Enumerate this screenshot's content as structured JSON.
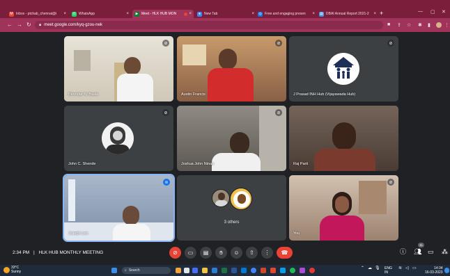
{
  "browser": {
    "tabs": [
      {
        "label": "Inbox - ptchab_chennai@i",
        "icon": "gmail-icon",
        "color": "#ea4335",
        "active": false
      },
      {
        "label": "WhatsApp",
        "icon": "whatsapp-icon",
        "color": "#25d366",
        "active": false
      },
      {
        "label": "Meet - HLK HUB MON",
        "icon": "meet-icon",
        "color": "#00832d",
        "active": true
      },
      {
        "label": "New Tab",
        "icon": "chrome-icon",
        "color": "#4285f4",
        "active": false
      },
      {
        "label": "Free and engaging presen",
        "icon": "mentimeter-icon",
        "color": "#1a73e8",
        "active": false
      },
      {
        "label": "DBAI Annual Report 2021-2",
        "icon": "pdf-icon",
        "color": "#4a90e2",
        "active": false
      }
    ],
    "tab_close_glyph": "×",
    "new_tab_glyph": "+",
    "url": "meet.google.com/kyq-gzou-nek",
    "accent": "#7b1e3b"
  },
  "participants": [
    {
      "name": "Birendar Kr Basla",
      "muted": true,
      "bg": "#8d8372"
    },
    {
      "name": "Austin Francis",
      "muted": true,
      "bg": "#a0755a"
    },
    {
      "name": "J Prasad INH Hub (Vijayawada Hub)",
      "muted": true,
      "bg": "#3c4043"
    },
    {
      "name": "John C. Shende",
      "muted": true,
      "bg": "#3c4043"
    },
    {
      "name": "Joshua John Ninan",
      "muted": true,
      "bg": "#6a6660"
    },
    {
      "name": "Raj Parit",
      "muted": false,
      "bg": "#5e4a40"
    },
    {
      "name": "Joseph Leo",
      "muted": false,
      "speaking": true,
      "bg": "#8fa0b5"
    },
    {
      "name": "3 others",
      "muted": false,
      "bg": "#3c4043"
    },
    {
      "name": "You",
      "muted": true,
      "bg": "#b49b86"
    }
  ],
  "meeting": {
    "time": "2:34 PM",
    "separator": "|",
    "title": "HLK HUB MONTHLY MEETING",
    "people_count": "11"
  },
  "taskbar": {
    "temperature": "33°C",
    "weather": "Sunny",
    "search_placeholder": "Search",
    "language": "ENG",
    "language_region": "IN",
    "clock_time": "14:34",
    "clock_date": "16-03-2023"
  }
}
